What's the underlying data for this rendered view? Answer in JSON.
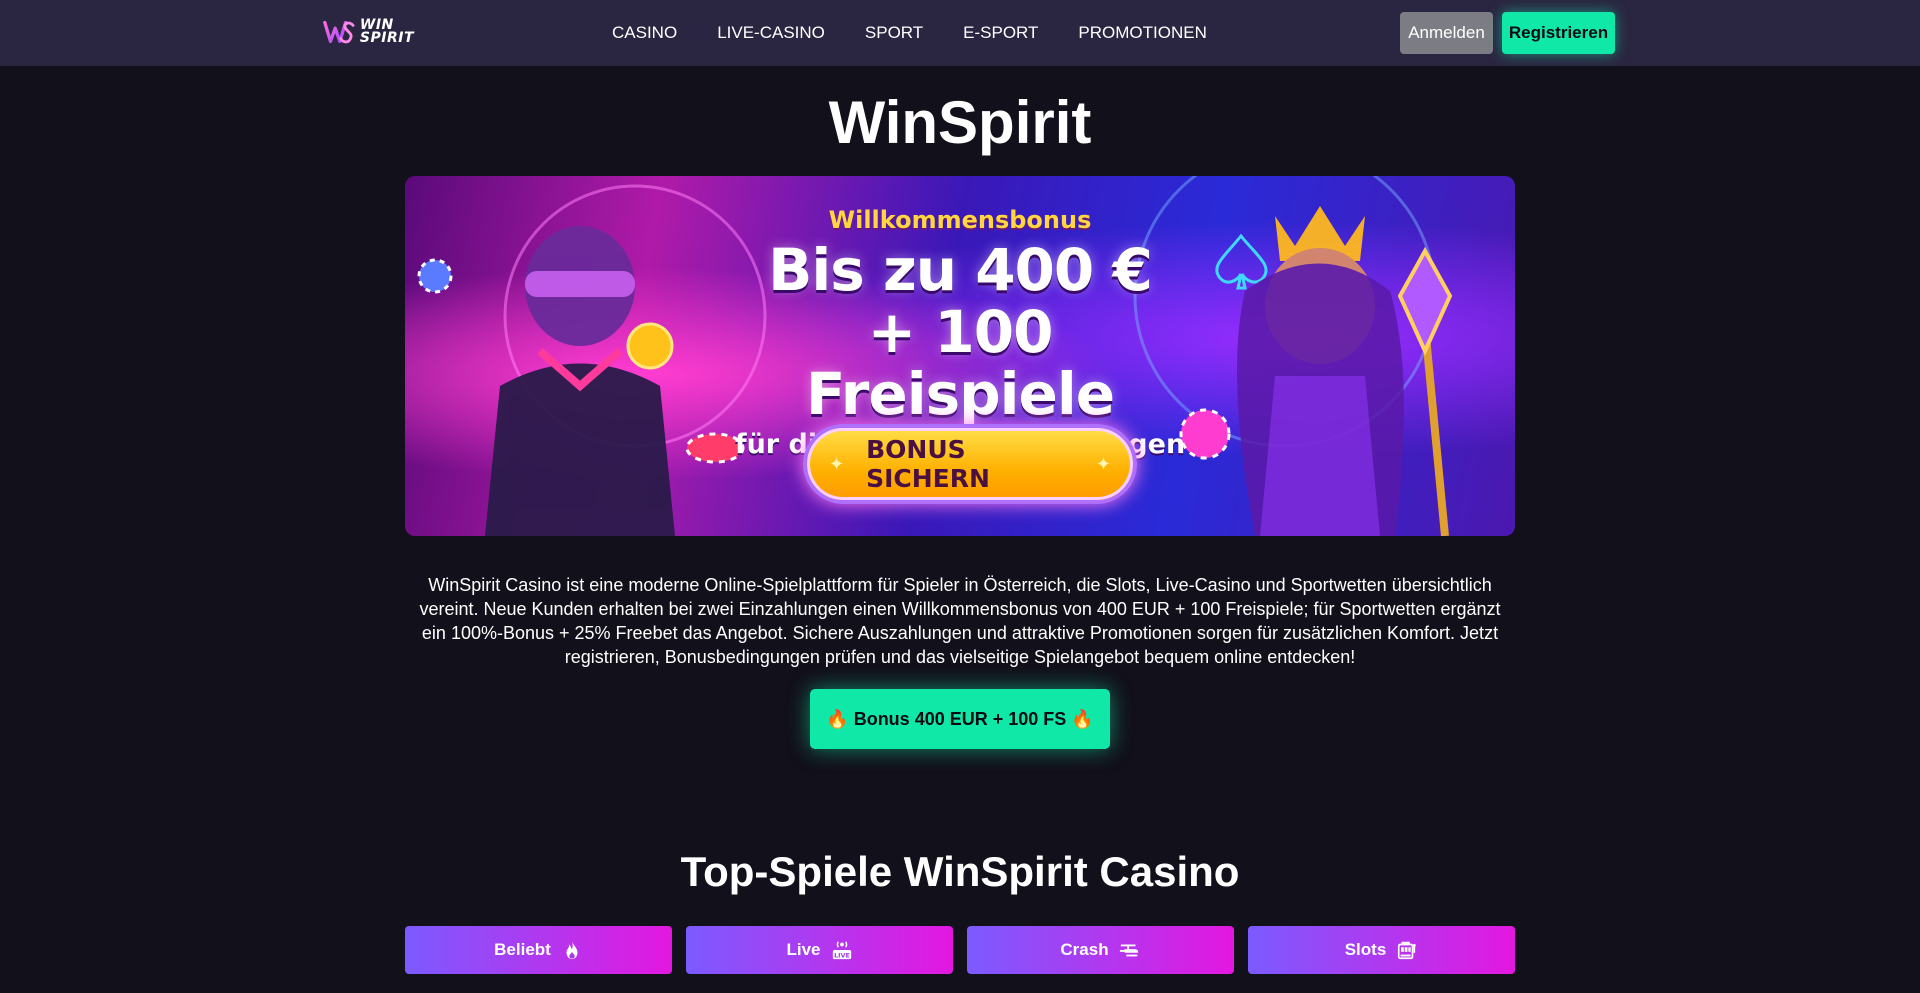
{
  "header": {
    "logo_line1": "WIN",
    "logo_line2": "SPIRIT",
    "nav": [
      "CASINO",
      "LIVE-CASINO",
      "SPORT",
      "E-SPORT",
      "PROMOTIONEN"
    ],
    "login_label": "Anmelden",
    "register_label": "Registrieren"
  },
  "hero": {
    "title": "WinSpirit"
  },
  "banner": {
    "kicker": "Willkommensbonus",
    "headline_line1": "Bis zu 400 €",
    "headline_line2": "+ 100 Freispiele",
    "subline": "für die ersten 2 Einzahlungen",
    "cta_label": "BONUS SICHERN"
  },
  "intro": {
    "text": "WinSpirit Casino ist eine moderne Online-Spielplattform für Spieler in Österreich, die Slots, Live-Casino und Sportwetten übersichtlich vereint. Neue Kunden erhalten bei zwei Einzahlungen einen Willkommensbonus von 400 EUR + 100 Freispiele; für Sportwetten ergänzt ein 100%-Bonus + 25% Freebet das Angebot. Sichere Auszahlungen und attraktive Promotionen sorgen für zusätzlichen Komfort. Jetzt registrieren, Bonusbedingungen prüfen und das vielseitige Spielangebot bequem online entdecken!",
    "bonus_button_label": "🔥 Bonus 400 EUR + 100 FS 🔥"
  },
  "games": {
    "title": "Top-Spiele WinSpirit Casino",
    "tabs": [
      {
        "label": "Beliebt",
        "icon": "flame-icon"
      },
      {
        "label": "Live",
        "icon": "live-broadcast-icon"
      },
      {
        "label": "Crash",
        "icon": "helicopter-icon"
      },
      {
        "label": "Slots",
        "icon": "slot-machine-icon"
      }
    ]
  },
  "colors": {
    "page_background": "#12101a",
    "header_background": "#2a2540",
    "accent_green": "#10e8a8",
    "tab_gradient_start": "#7b5bff",
    "tab_gradient_end": "#e417e0",
    "banner_gold": "#ffd640"
  }
}
